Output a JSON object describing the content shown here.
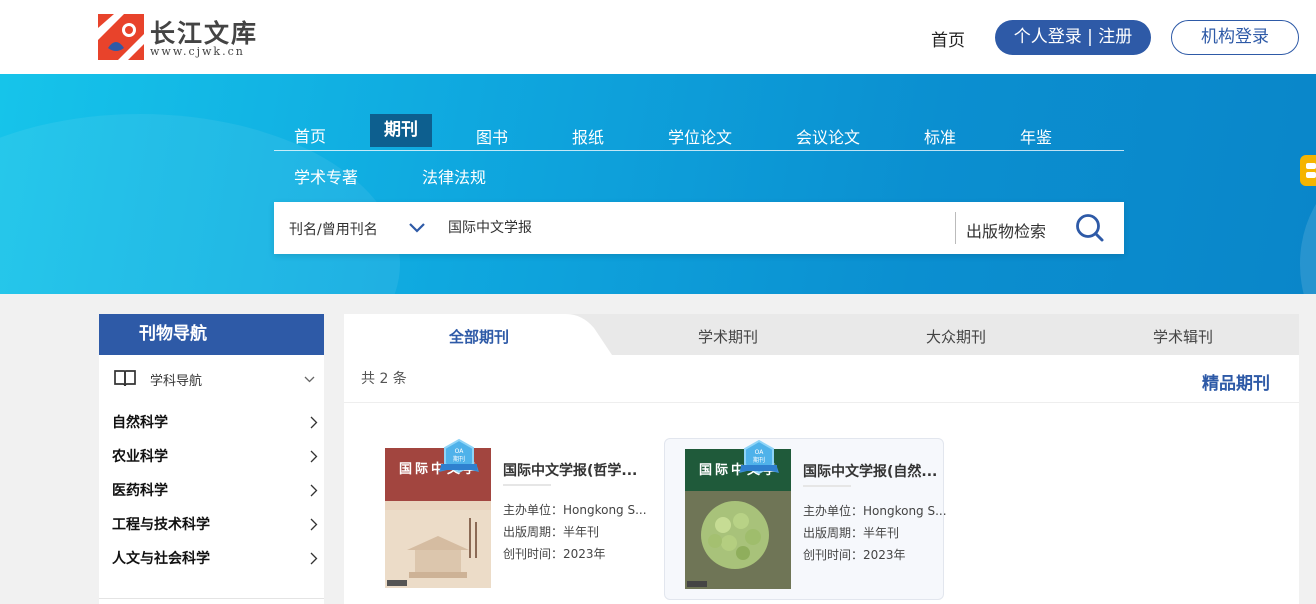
{
  "header": {
    "logo_text": "长江文库",
    "logo_url": "www.cjwk.cn",
    "home_label": "首页",
    "login_label": "个人登录 | 注册",
    "org_login_label": "机构登录"
  },
  "nav": {
    "items": [
      "首页",
      "期刊",
      "图书",
      "报纸",
      "学位论文",
      "会议论文",
      "标准",
      "年鉴",
      "学术专著",
      "法律法规"
    ],
    "active": "期刊"
  },
  "search": {
    "type_label": "刊名/曾用刊名",
    "value": "国际中文学报",
    "scope_label": "出版物检索"
  },
  "sidebar": {
    "title": "刊物导航",
    "subject_label": "学科导航",
    "categories": [
      "自然科学",
      "农业科学",
      "医药科学",
      "工程与技术科学",
      "人文与社会科学"
    ]
  },
  "tabs": [
    "全部期刊",
    "学术期刊",
    "大众期刊",
    "学术辑刊"
  ],
  "results": {
    "count_text": "共 2 条",
    "section_title": "精品期刊",
    "cards": [
      {
        "title": "国际中文学报(哲学...",
        "cover_title": "国际中文学",
        "cover_color": "#a2453f",
        "badge": "OA期刊",
        "publisher": "主办单位：Hongkong S...",
        "period": "出版周期：半年刊",
        "founded": "创刊时间：2023年"
      },
      {
        "title": "国际中文学报(自然...",
        "cover_title": "国际中文学",
        "cover_color": "#1f5a3a",
        "badge": "OA期刊",
        "publisher": "主办单位：Hongkong S...",
        "period": "出版周期：半年刊",
        "founded": "创刊时间：2023年"
      }
    ]
  },
  "colors": {
    "brand": "#2e5aa7",
    "banner": "#0f9ad6",
    "nav_active_bg": "#0d5f8f",
    "side_tab": "#f5b400"
  }
}
